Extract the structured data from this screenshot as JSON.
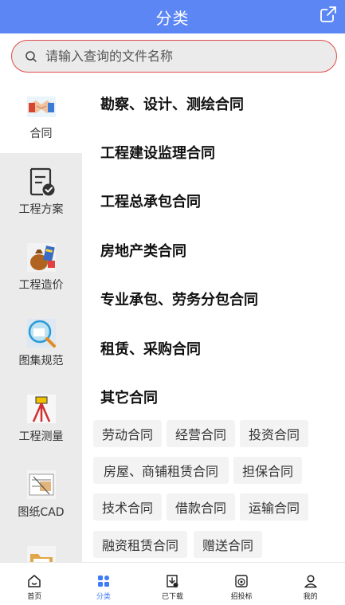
{
  "header": {
    "title": "分类"
  },
  "search": {
    "placeholder": "请输入查询的文件名称"
  },
  "sidebar": {
    "items": [
      {
        "label": "合同",
        "icon": "handshake-icon",
        "active": true
      },
      {
        "label": "工程方案",
        "icon": "document-check-icon",
        "active": false
      },
      {
        "label": "工程造价",
        "icon": "money-bag-icon",
        "active": false
      },
      {
        "label": "图集规范",
        "icon": "magnifier-book-icon",
        "active": false
      },
      {
        "label": "工程测量",
        "icon": "survey-tripod-icon",
        "active": false
      },
      {
        "label": "图纸CAD",
        "icon": "blueprint-icon",
        "active": false
      },
      {
        "label": "",
        "icon": "folder-icon",
        "active": false
      }
    ]
  },
  "main": {
    "categories": [
      {
        "title": "勘察、设计、测绘合同"
      },
      {
        "title": "工程建设监理合同"
      },
      {
        "title": "工程总承包合同"
      },
      {
        "title": "房地产类合同"
      },
      {
        "title": "专业承包、劳务分包合同"
      },
      {
        "title": "租赁、采购合同"
      },
      {
        "title": "其它合同"
      }
    ],
    "tags": [
      "劳动合同",
      "经营合同",
      "投资合同",
      "房屋、商铺租赁合同",
      "担保合同",
      "技术合同",
      "借款合同",
      "运输合同",
      "融资租赁合同",
      "赠送合同"
    ]
  },
  "bottom_nav": {
    "items": [
      {
        "label": "首页",
        "icon": "home-icon"
      },
      {
        "label": "分类",
        "icon": "category-grid-icon",
        "active": true
      },
      {
        "label": "已下载",
        "icon": "download-icon"
      },
      {
        "label": "招投标",
        "icon": "bid-target-icon"
      },
      {
        "label": "我的",
        "icon": "user-icon"
      }
    ]
  },
  "colors": {
    "header": "#5b86f4",
    "accent": "#3d7bf7",
    "search_border": "#e04a4a"
  }
}
